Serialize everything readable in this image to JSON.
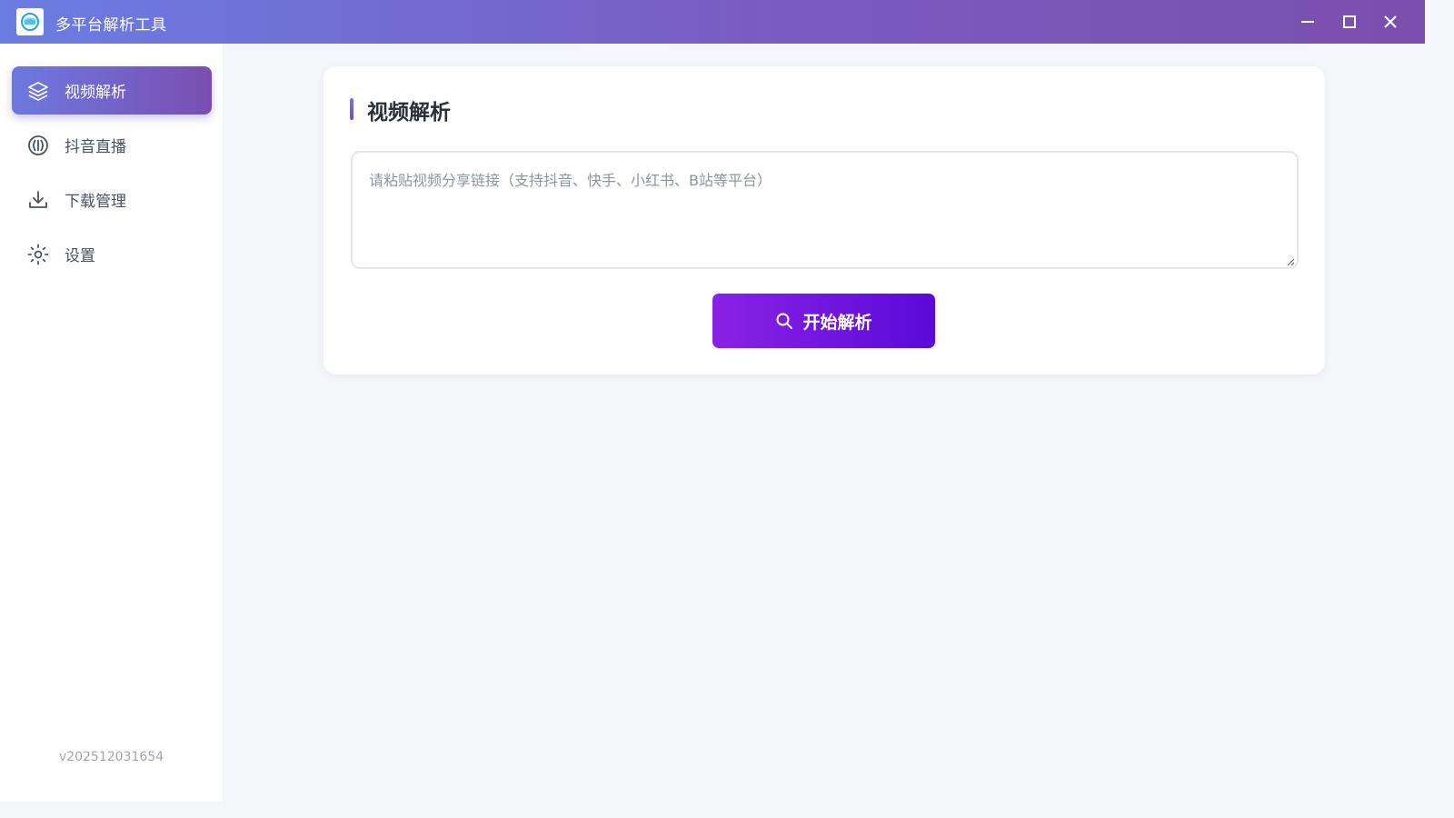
{
  "app": {
    "title": "多平台解析工具",
    "logo_icon": "app-logo-icon"
  },
  "window_controls": {
    "minimize_icon": "minimize-icon",
    "maximize_icon": "maximize-icon",
    "close_icon": "close-icon"
  },
  "sidebar": {
    "items": [
      {
        "label": "视频解析",
        "icon": "layers-icon",
        "active": true
      },
      {
        "label": "抖音直播",
        "icon": "douyin-live-icon",
        "active": false
      },
      {
        "label": "下载管理",
        "icon": "download-icon",
        "active": false
      },
      {
        "label": "设置",
        "icon": "sun-settings-icon",
        "active": false
      }
    ],
    "version": "v202512031654"
  },
  "main": {
    "title": "视频解析",
    "input": {
      "value": "",
      "placeholder": "请粘贴视频分享链接（支持抖音、快手、小红书、B站等平台）"
    },
    "parse_button": {
      "label": "开始解析",
      "icon": "search-icon"
    }
  },
  "colors": {
    "titlebar_start": "#6a7de2",
    "titlebar_end": "#7a4fae",
    "active_nav_start": "#6d79e0",
    "active_nav_end": "#7a4eb0",
    "button_start": "#8a22e6",
    "button_end": "#5a0ad8",
    "background": "#f4f6fa"
  }
}
